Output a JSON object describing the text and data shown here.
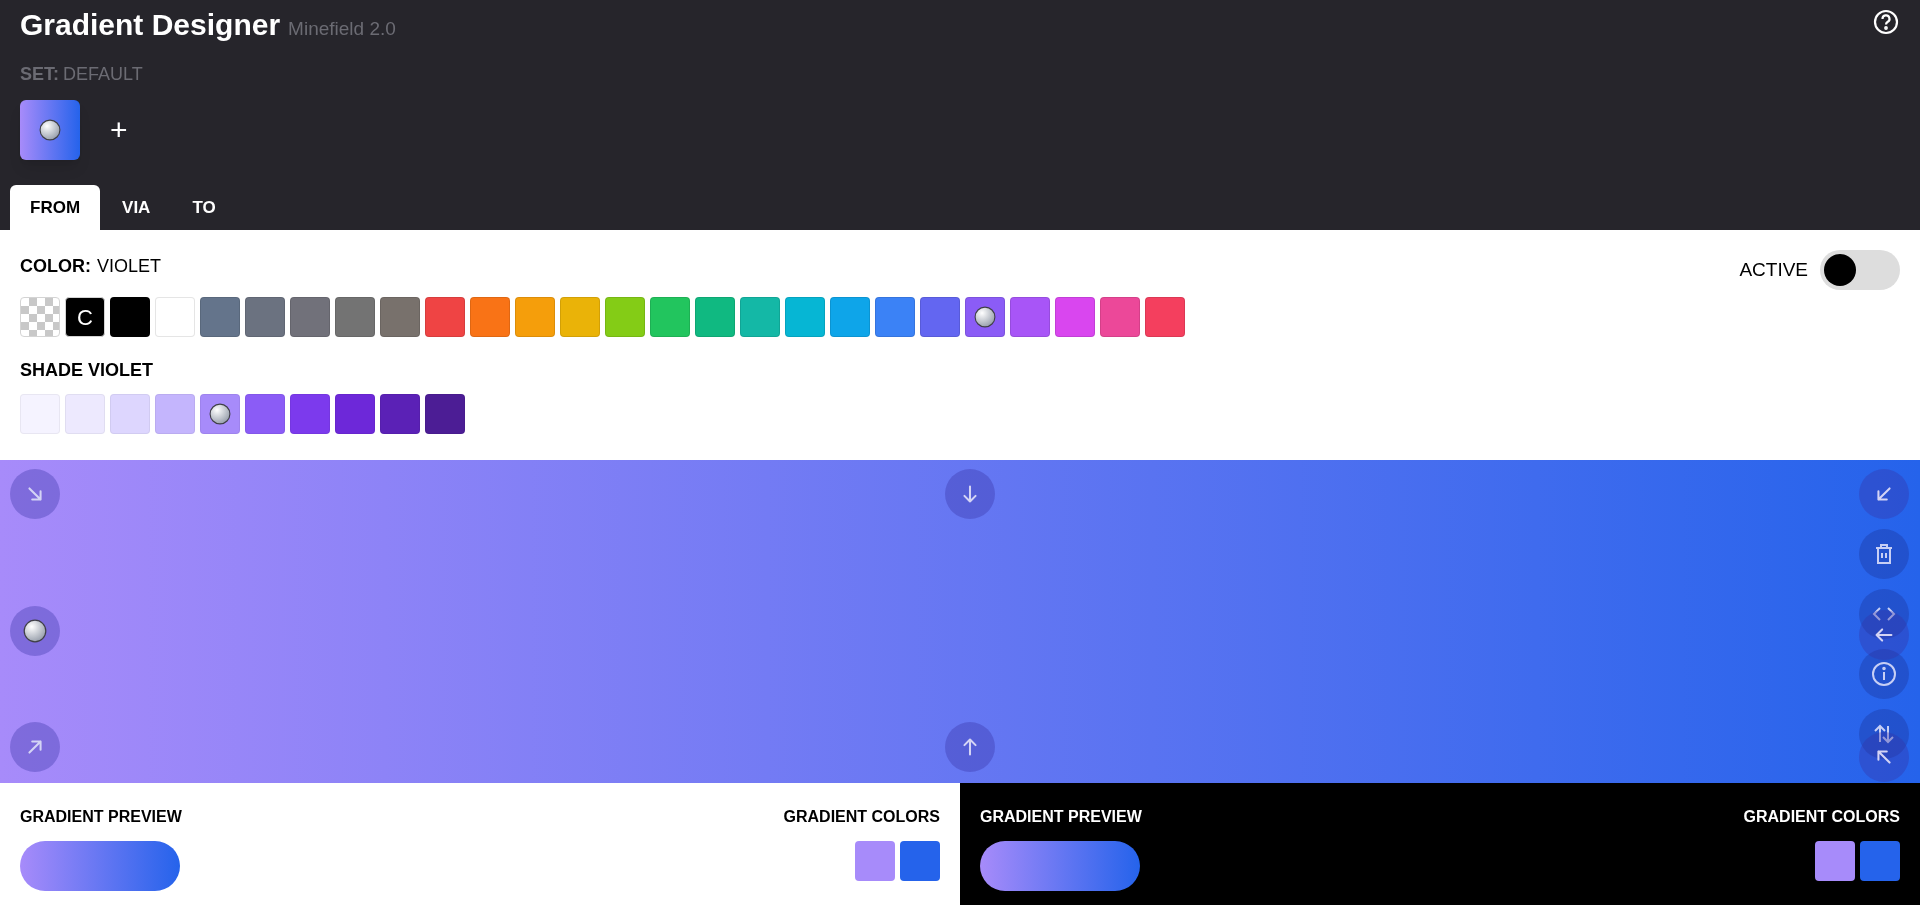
{
  "header": {
    "title": "Gradient Designer",
    "subtitle": "Minefield 2.0",
    "set_label": "SET:",
    "set_name": "DEFAULT"
  },
  "sets": [
    {
      "selected": true
    }
  ],
  "add_set": "+",
  "tabs": [
    {
      "label": "FROM",
      "selected": true
    },
    {
      "label": "VIA",
      "selected": false
    },
    {
      "label": "TO",
      "selected": false
    }
  ],
  "color_label": "COLOR:",
  "color_name": "VIOLET",
  "active_toggle": {
    "label": "ACTIVE",
    "on": false
  },
  "colors": [
    {
      "kind": "transparent",
      "selected": false
    },
    {
      "kind": "current",
      "text": "C",
      "selected": false
    },
    {
      "kind": "color",
      "color": "#000000",
      "selected": false
    },
    {
      "kind": "color",
      "color": "#ffffff",
      "selected": false
    },
    {
      "kind": "color",
      "color": "#64748b",
      "selected": false
    },
    {
      "kind": "color",
      "color": "#6b7280",
      "selected": false
    },
    {
      "kind": "color",
      "color": "#71717a",
      "selected": false
    },
    {
      "kind": "color",
      "color": "#737373",
      "selected": false
    },
    {
      "kind": "color",
      "color": "#78716c",
      "selected": false
    },
    {
      "kind": "color",
      "color": "#ef4444",
      "selected": false
    },
    {
      "kind": "color",
      "color": "#f97316",
      "selected": false
    },
    {
      "kind": "color",
      "color": "#f59e0b",
      "selected": false
    },
    {
      "kind": "color",
      "color": "#eab308",
      "selected": false
    },
    {
      "kind": "color",
      "color": "#84cc16",
      "selected": false
    },
    {
      "kind": "color",
      "color": "#22c55e",
      "selected": false
    },
    {
      "kind": "color",
      "color": "#10b981",
      "selected": false
    },
    {
      "kind": "color",
      "color": "#14b8a6",
      "selected": false
    },
    {
      "kind": "color",
      "color": "#06b6d4",
      "selected": false
    },
    {
      "kind": "color",
      "color": "#0ea5e9",
      "selected": false
    },
    {
      "kind": "color",
      "color": "#3b82f6",
      "selected": false
    },
    {
      "kind": "color",
      "color": "#6366f1",
      "selected": false
    },
    {
      "kind": "color",
      "color": "#8b5cf6",
      "selected": true
    },
    {
      "kind": "color",
      "color": "#a855f7",
      "selected": false
    },
    {
      "kind": "color",
      "color": "#d946ef",
      "selected": false
    },
    {
      "kind": "color",
      "color": "#ec4899",
      "selected": false
    },
    {
      "kind": "color",
      "color": "#f43f5e",
      "selected": false
    }
  ],
  "shade_label": "SHADE VIOLET",
  "shades": [
    {
      "color": "#f5f3ff",
      "selected": false
    },
    {
      "color": "#ede9fe",
      "selected": false
    },
    {
      "color": "#ddd6fe",
      "selected": false
    },
    {
      "color": "#c4b5fd",
      "selected": false
    },
    {
      "color": "#a78bfa",
      "selected": true
    },
    {
      "color": "#8b5cf6",
      "selected": false
    },
    {
      "color": "#7c3aed",
      "selected": false
    },
    {
      "color": "#6d28d9",
      "selected": false
    },
    {
      "color": "#5b21b6",
      "selected": false
    },
    {
      "color": "#4c1d95",
      "selected": false
    }
  ],
  "directions": [
    {
      "kind": "to-br",
      "selected": false
    },
    {
      "kind": "to-b",
      "selected": false
    },
    {
      "kind": "to-bl",
      "selected": false
    },
    {
      "kind": "to-r",
      "selected": true
    },
    {
      "kind": "to-l",
      "selected": false
    },
    {
      "kind": "to-tr",
      "selected": false
    },
    {
      "kind": "to-t",
      "selected": false
    },
    {
      "kind": "to-tl",
      "selected": false
    }
  ],
  "previews": [
    {
      "kind": "light",
      "preview_label": "GRADIENT PREVIEW",
      "colors_label": "GRADIENT COLORS"
    },
    {
      "kind": "dark",
      "preview_label": "GRADIENT PREVIEW",
      "colors_label": "GRADIENT COLORS"
    }
  ],
  "gradient_colors": [
    {
      "color": "#a78bfa"
    },
    {
      "color": "#2563eb"
    }
  ]
}
